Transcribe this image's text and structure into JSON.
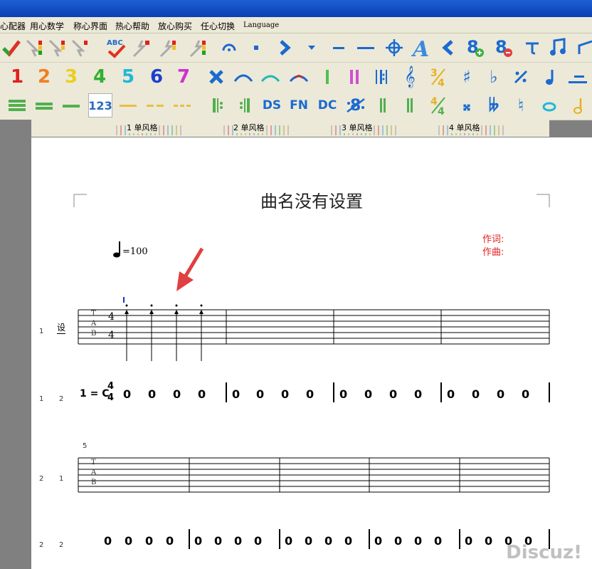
{
  "menu": {
    "items": [
      "心配器",
      "用心数学",
      "称心界面",
      "热心帮助",
      "放心购买",
      "任心切换",
      "Language"
    ]
  },
  "toolbar2": {
    "nums": [
      "1",
      "2",
      "3",
      "4",
      "5",
      "6",
      "7"
    ]
  },
  "toolbar3": {
    "num_btn": "123",
    "ds": "DS",
    "fn": "FN",
    "dc": "DC"
  },
  "ruler": {
    "labels": [
      "1 单风格",
      "2 单风格",
      "3 单风格",
      "4 单风格"
    ]
  },
  "score": {
    "title": "曲名没有设置",
    "lyricist": "作词:",
    "composer": "作曲:",
    "tempo": "=100",
    "cursor": "I",
    "track_label": "设",
    "row_nums": [
      "1",
      "1",
      "2",
      "2",
      "1",
      "2",
      "2"
    ],
    "tab_letters": [
      "T",
      "A",
      "B"
    ],
    "time_top": "4",
    "time_bottom": "4",
    "key": "1 = C",
    "measure_num": "5",
    "notes_row1": [
      "0",
      "0",
      "0",
      "0",
      "0",
      "0",
      "0",
      "0",
      "0",
      "0",
      "0",
      "0",
      "0",
      "0",
      "0",
      "0"
    ],
    "notes_row2": [
      "0",
      "0",
      "0",
      "0",
      "0",
      "0",
      "0",
      "0",
      "0",
      "0",
      "0",
      "0",
      "0",
      "0",
      "0",
      "0",
      "0",
      "0",
      "0",
      "0"
    ]
  },
  "watermark": "Discuz!"
}
